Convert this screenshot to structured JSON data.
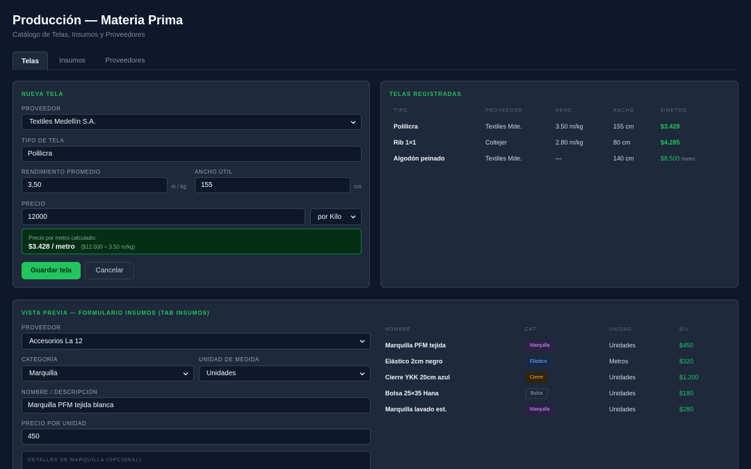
{
  "header": {
    "title": "Producción — Materia Prima",
    "subtitle": "Catálogo de Telas, Insumos y Proveedores"
  },
  "tabs": [
    {
      "label": "Telas",
      "active": true
    },
    {
      "label": "Insumos",
      "active": false
    },
    {
      "label": "Proveedores",
      "active": false
    }
  ],
  "nueva_tela": {
    "title": "NUEVA TELA",
    "proveedor_label": "PROVEEDOR",
    "proveedor_value": "Textiles Medellín S.A.",
    "tipo_label": "TIPO DE TELA",
    "tipo_value": "Polilicra",
    "rendimiento_label": "RENDIMIENTO PROMEDIO",
    "rendimiento_value": "3,50",
    "rendimiento_unit": "m / kg",
    "ancho_label": "ANCHO ÚTIL",
    "ancho_value": "155",
    "ancho_unit": "cm",
    "precio_label": "PRECIO",
    "precio_value": "12000",
    "precio_unit_value": "por Kilo",
    "calc_line1": "Precio por metro calculado:",
    "calc_value": "$3.428 / metro",
    "calc_note": "($12.000 ÷ 3.50 m/kg)",
    "save_label": "Guardar tela",
    "cancel_label": "Cancelar"
  },
  "telas_registradas": {
    "title": "TELAS REGISTRADAS",
    "columns": [
      "TIPO",
      "PROVEEDOR",
      "REND.",
      "ANCHO",
      "$/METRO"
    ],
    "rows": [
      {
        "tipo": "Polilicra",
        "proveedor": "Textiles Mde.",
        "rend": "3.50 m/kg",
        "ancho": "155 cm",
        "precio": "$3.428",
        "suffix": ""
      },
      {
        "tipo": "Rib 1×1",
        "proveedor": "Coltejer",
        "rend": "2.80 m/kg",
        "ancho": "80 cm",
        "precio": "$4.285",
        "suffix": ""
      },
      {
        "tipo": "Algodón peinado",
        "proveedor": "Textiles Mde.",
        "rend": "—",
        "ancho": "140 cm",
        "precio": "$8.500",
        "suffix": "/metro"
      }
    ]
  },
  "vista_previa": {
    "title": "VISTA PREVIA — FORMULARIO INSUMOS (TAB INSUMOS)",
    "proveedor_label": "PROVEEDOR",
    "proveedor_value": "Accesorios La 12",
    "categoria_label": "CATEGORÍA",
    "categoria_value": "Marquilla",
    "unidad_label": "UNIDAD DE MEDIDA",
    "unidad_value": "Unidades",
    "nombre_label": "NOMBRE / DESCRIPCIÓN",
    "nombre_value": "Marquilla PFM tejida blanca",
    "precio_label": "PRECIO POR UNIDAD",
    "precio_value": "450",
    "detalles_placeholder": "DETALLES DE MARQUILLA (OPCIONAL)"
  },
  "insumos": {
    "columns": [
      "NOMBRE",
      "CAT.",
      "UNIDAD",
      "$/U"
    ],
    "rows": [
      {
        "nombre": "Marquilla PFM tejida",
        "cat": "Marquilla",
        "cat_style": "marq",
        "unidad": "Unidades",
        "precio": "$450"
      },
      {
        "nombre": "Elástico 2cm negro",
        "cat": "Elástico",
        "cat_style": "elas",
        "unidad": "Metros",
        "precio": "$320"
      },
      {
        "nombre": "Cierre YKK 20cm azul",
        "cat": "Cierre",
        "cat_style": "cier",
        "unidad": "Unidades",
        "precio": "$1.200"
      },
      {
        "nombre": "Bolsa 25×35 Hana",
        "cat": "Bolsa",
        "cat_style": "bols",
        "unidad": "Unidades",
        "precio": "$180"
      },
      {
        "nombre": "Marquilla lavado est.",
        "cat": "Marquilla",
        "cat_style": "marq",
        "unidad": "Unidades",
        "precio": "$280"
      }
    ]
  },
  "colors": {
    "accent": "#22c55e",
    "background": "#0f172a",
    "card": "#1e293b",
    "border": "#334155"
  }
}
